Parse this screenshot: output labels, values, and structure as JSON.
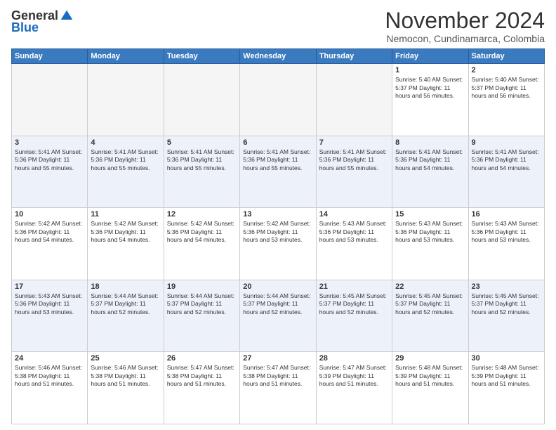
{
  "header": {
    "logo_general": "General",
    "logo_blue": "Blue",
    "month_title": "November 2024",
    "location": "Nemocon, Cundinamarca, Colombia"
  },
  "weekdays": [
    "Sunday",
    "Monday",
    "Tuesday",
    "Wednesday",
    "Thursday",
    "Friday",
    "Saturday"
  ],
  "weeks": [
    [
      {
        "day": "",
        "info": ""
      },
      {
        "day": "",
        "info": ""
      },
      {
        "day": "",
        "info": ""
      },
      {
        "day": "",
        "info": ""
      },
      {
        "day": "",
        "info": ""
      },
      {
        "day": "1",
        "info": "Sunrise: 5:40 AM\nSunset: 5:37 PM\nDaylight: 11 hours\nand 56 minutes."
      },
      {
        "day": "2",
        "info": "Sunrise: 5:40 AM\nSunset: 5:37 PM\nDaylight: 11 hours\nand 56 minutes."
      }
    ],
    [
      {
        "day": "3",
        "info": "Sunrise: 5:41 AM\nSunset: 5:36 PM\nDaylight: 11 hours\nand 55 minutes."
      },
      {
        "day": "4",
        "info": "Sunrise: 5:41 AM\nSunset: 5:36 PM\nDaylight: 11 hours\nand 55 minutes."
      },
      {
        "day": "5",
        "info": "Sunrise: 5:41 AM\nSunset: 5:36 PM\nDaylight: 11 hours\nand 55 minutes."
      },
      {
        "day": "6",
        "info": "Sunrise: 5:41 AM\nSunset: 5:36 PM\nDaylight: 11 hours\nand 55 minutes."
      },
      {
        "day": "7",
        "info": "Sunrise: 5:41 AM\nSunset: 5:36 PM\nDaylight: 11 hours\nand 55 minutes."
      },
      {
        "day": "8",
        "info": "Sunrise: 5:41 AM\nSunset: 5:36 PM\nDaylight: 11 hours\nand 54 minutes."
      },
      {
        "day": "9",
        "info": "Sunrise: 5:41 AM\nSunset: 5:36 PM\nDaylight: 11 hours\nand 54 minutes."
      }
    ],
    [
      {
        "day": "10",
        "info": "Sunrise: 5:42 AM\nSunset: 5:36 PM\nDaylight: 11 hours\nand 54 minutes."
      },
      {
        "day": "11",
        "info": "Sunrise: 5:42 AM\nSunset: 5:36 PM\nDaylight: 11 hours\nand 54 minutes."
      },
      {
        "day": "12",
        "info": "Sunrise: 5:42 AM\nSunset: 5:36 PM\nDaylight: 11 hours\nand 54 minutes."
      },
      {
        "day": "13",
        "info": "Sunrise: 5:42 AM\nSunset: 5:36 PM\nDaylight: 11 hours\nand 53 minutes."
      },
      {
        "day": "14",
        "info": "Sunrise: 5:43 AM\nSunset: 5:36 PM\nDaylight: 11 hours\nand 53 minutes."
      },
      {
        "day": "15",
        "info": "Sunrise: 5:43 AM\nSunset: 5:36 PM\nDaylight: 11 hours\nand 53 minutes."
      },
      {
        "day": "16",
        "info": "Sunrise: 5:43 AM\nSunset: 5:36 PM\nDaylight: 11 hours\nand 53 minutes."
      }
    ],
    [
      {
        "day": "17",
        "info": "Sunrise: 5:43 AM\nSunset: 5:36 PM\nDaylight: 11 hours\nand 53 minutes."
      },
      {
        "day": "18",
        "info": "Sunrise: 5:44 AM\nSunset: 5:37 PM\nDaylight: 11 hours\nand 52 minutes."
      },
      {
        "day": "19",
        "info": "Sunrise: 5:44 AM\nSunset: 5:37 PM\nDaylight: 11 hours\nand 52 minutes."
      },
      {
        "day": "20",
        "info": "Sunrise: 5:44 AM\nSunset: 5:37 PM\nDaylight: 11 hours\nand 52 minutes."
      },
      {
        "day": "21",
        "info": "Sunrise: 5:45 AM\nSunset: 5:37 PM\nDaylight: 11 hours\nand 52 minutes."
      },
      {
        "day": "22",
        "info": "Sunrise: 5:45 AM\nSunset: 5:37 PM\nDaylight: 11 hours\nand 52 minutes."
      },
      {
        "day": "23",
        "info": "Sunrise: 5:45 AM\nSunset: 5:37 PM\nDaylight: 11 hours\nand 52 minutes."
      }
    ],
    [
      {
        "day": "24",
        "info": "Sunrise: 5:46 AM\nSunset: 5:38 PM\nDaylight: 11 hours\nand 51 minutes."
      },
      {
        "day": "25",
        "info": "Sunrise: 5:46 AM\nSunset: 5:38 PM\nDaylight: 11 hours\nand 51 minutes."
      },
      {
        "day": "26",
        "info": "Sunrise: 5:47 AM\nSunset: 5:38 PM\nDaylight: 11 hours\nand 51 minutes."
      },
      {
        "day": "27",
        "info": "Sunrise: 5:47 AM\nSunset: 5:38 PM\nDaylight: 11 hours\nand 51 minutes."
      },
      {
        "day": "28",
        "info": "Sunrise: 5:47 AM\nSunset: 5:39 PM\nDaylight: 11 hours\nand 51 minutes."
      },
      {
        "day": "29",
        "info": "Sunrise: 5:48 AM\nSunset: 5:39 PM\nDaylight: 11 hours\nand 51 minutes."
      },
      {
        "day": "30",
        "info": "Sunrise: 5:48 AM\nSunset: 5:39 PM\nDaylight: 11 hours\nand 51 minutes."
      }
    ]
  ]
}
